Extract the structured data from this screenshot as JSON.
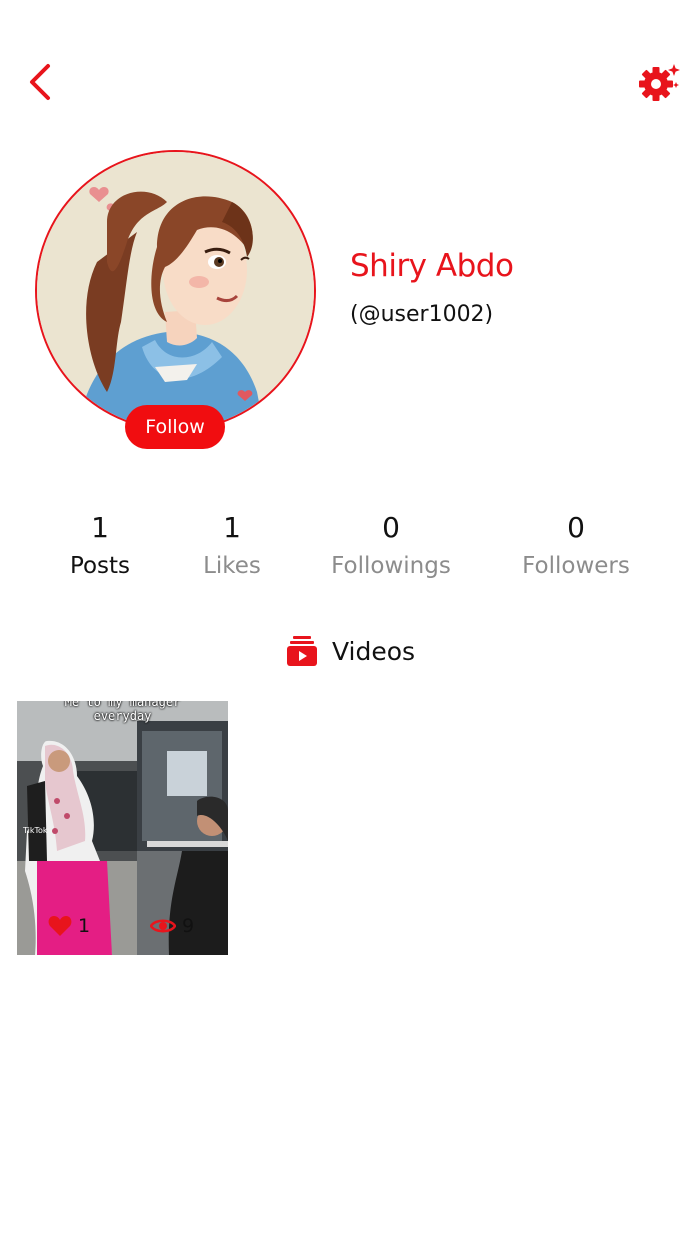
{
  "header": {
    "back_icon": "chevron-left-icon",
    "settings_icon": "gear-sparkle-icon",
    "accent_color": "#e8141c"
  },
  "profile": {
    "name": "Shiry Abdo",
    "handle": "(@user1002)",
    "follow_label": "Follow"
  },
  "stats": [
    {
      "value": "1",
      "label": "Posts"
    },
    {
      "value": "1",
      "label": "Likes"
    },
    {
      "value": "0",
      "label": "Followings"
    },
    {
      "value": "0",
      "label": "Followers"
    }
  ],
  "section": {
    "title": "Videos",
    "icon": "video-stack-icon"
  },
  "videos": [
    {
      "caption": "Me to my manager\neveryday",
      "likes": "1",
      "views": "9"
    }
  ]
}
